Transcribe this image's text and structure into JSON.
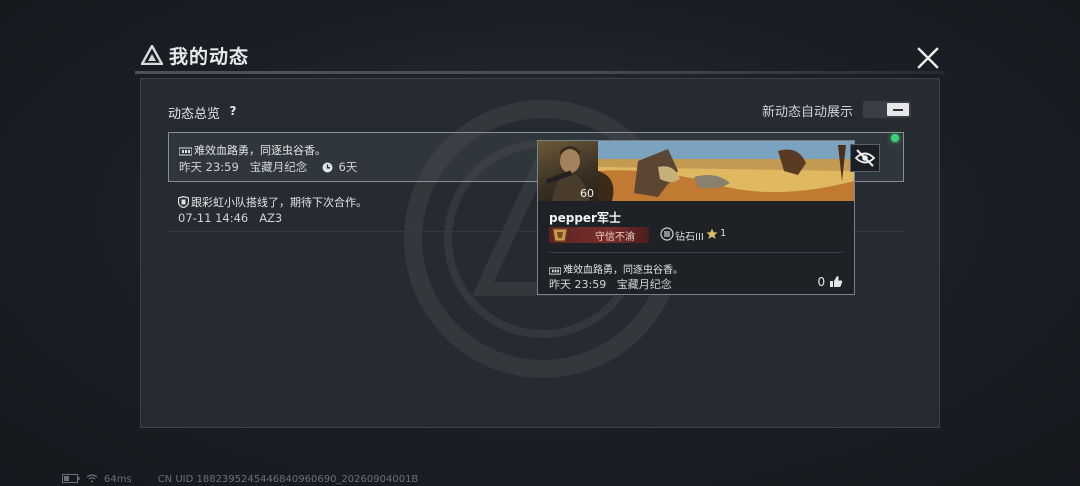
{
  "window": {
    "title": "我的动态"
  },
  "overview": {
    "label": "动态总览",
    "help": "?"
  },
  "auto_show": {
    "label": "新动态自动展示"
  },
  "feed": [
    {
      "text": "难效血路勇，同逐虫谷香。",
      "time": "昨天 23:59",
      "tag": "宝藏月纪念",
      "duration": "6天"
    },
    {
      "text": "跟彩虹小队搭线了，期待下次合作。",
      "time": "07-11 14:46",
      "tag": "AZ3"
    }
  ],
  "card": {
    "level": "60",
    "name": "pepper军士",
    "rank_title": "守信不渝",
    "tier": "钻石III",
    "stars": "1",
    "text": "难效血路勇，同逐虫谷香。",
    "time": "昨天 23:59",
    "tag": "宝藏月纪念",
    "likes": "0"
  },
  "status": {
    "ping": "64ms",
    "uid": "CN UID 1882395245446840960690_20260904001B"
  },
  "colors": {
    "panel": "#262b31",
    "online": "#3fcf7a",
    "rank": "#7a2f2b"
  },
  "icons": [
    "title-logo-icon",
    "close-icon",
    "help-icon",
    "toggle",
    "medal-icon",
    "clock-icon",
    "shield-icon",
    "hide-eye-icon",
    "thumbs-up-icon",
    "battery-icon",
    "wifi-icon"
  ]
}
